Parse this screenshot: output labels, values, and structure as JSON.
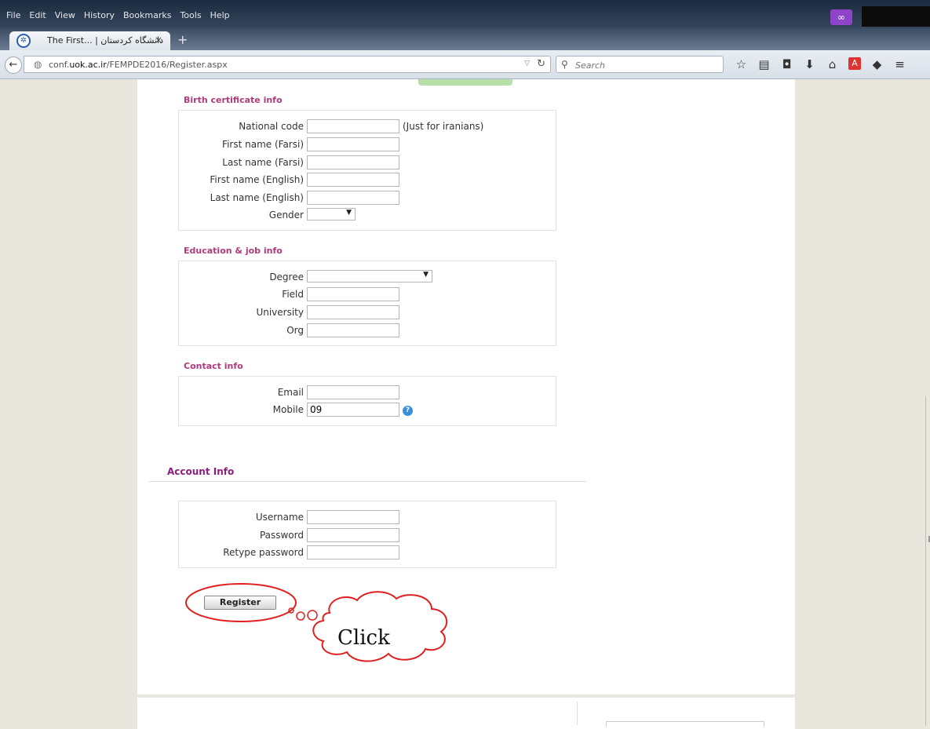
{
  "menu": [
    "File",
    "Edit",
    "View",
    "History",
    "Bookmarks",
    "Tools",
    "Help"
  ],
  "tab": {
    "title": "The First... | دانشگاه کردستان",
    "close": "×",
    "new_tab": "+"
  },
  "url": {
    "prefix": "conf.",
    "domain": "uok.ac.ir",
    "path": "/FEMPDE2016/Register.aspx"
  },
  "search": {
    "placeholder": "Search"
  },
  "sections": {
    "birth": {
      "title": "Birth certificate info",
      "national_code": "National code",
      "national_note": "(Just for iranians)",
      "first_fa": "First name (Farsi)",
      "last_fa": "Last name (Farsi)",
      "first_en": "First name (English)",
      "last_en": "Last name (English)",
      "gender": "Gender"
    },
    "education": {
      "title": "Education & job info",
      "degree": "Degree",
      "field": "Field",
      "university": "University",
      "org": "Org"
    },
    "contact": {
      "title": "Contact info",
      "email": "Email",
      "mobile": "Mobile",
      "mobile_value": "09",
      "help": "?"
    },
    "account": {
      "title": "Account Info",
      "username": "Username",
      "password": "Password",
      "retype": "Retype password"
    }
  },
  "register_label": "Register",
  "callout_text": "Click",
  "colors": {
    "section_title": "#b03a7e",
    "account_title": "#8b1f7c",
    "callout": "#e02020"
  }
}
